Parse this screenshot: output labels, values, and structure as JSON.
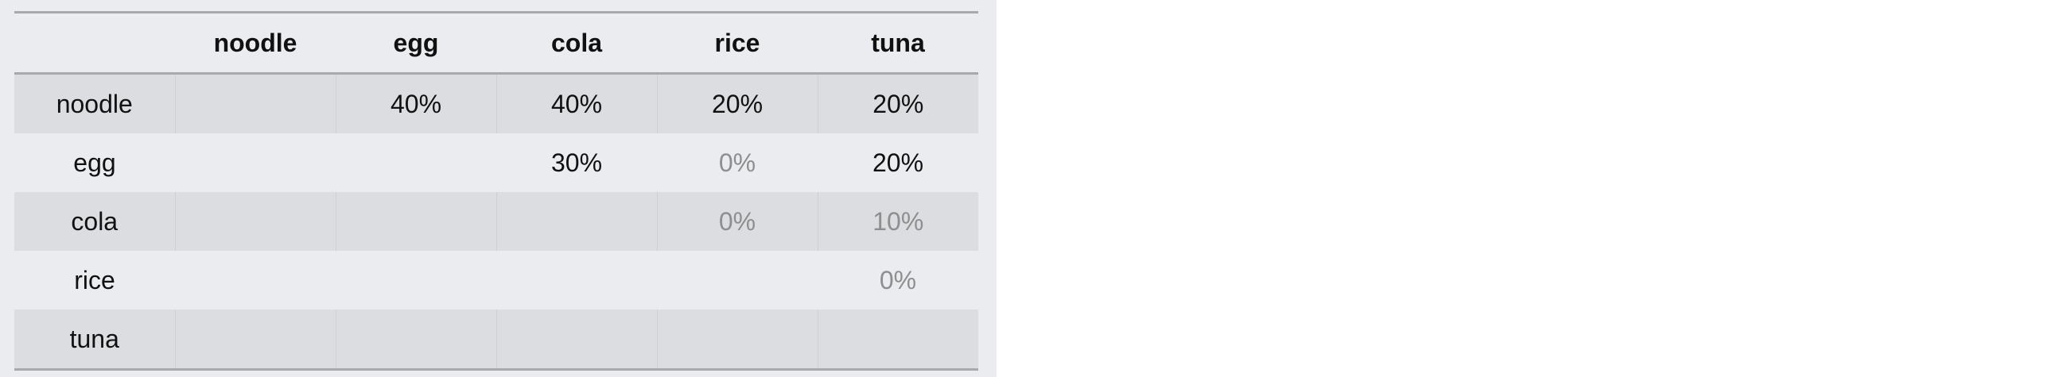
{
  "chart_data": {
    "type": "table",
    "columns": [
      "noodle",
      "egg",
      "cola",
      "rice",
      "tuna"
    ],
    "rows": [
      {
        "label": "noodle",
        "cells": [
          "",
          "40%",
          "40%",
          "20%",
          "20%"
        ]
      },
      {
        "label": "egg",
        "cells": [
          "",
          "",
          "30%",
          "0%",
          "20%"
        ]
      },
      {
        "label": "cola",
        "cells": [
          "",
          "",
          "",
          "0%",
          "10%"
        ]
      },
      {
        "label": "rice",
        "cells": [
          "",
          "",
          "",
          "",
          "0%"
        ]
      },
      {
        "label": "tuna",
        "cells": [
          "",
          "",
          "",
          "",
          ""
        ]
      }
    ],
    "colors": {
      "panel_background": "#ebecf0",
      "band_background": "#dcdde1",
      "rule": "#a9a9ad",
      "text": "#111111",
      "muted_text": "#8e8e8e"
    }
  }
}
